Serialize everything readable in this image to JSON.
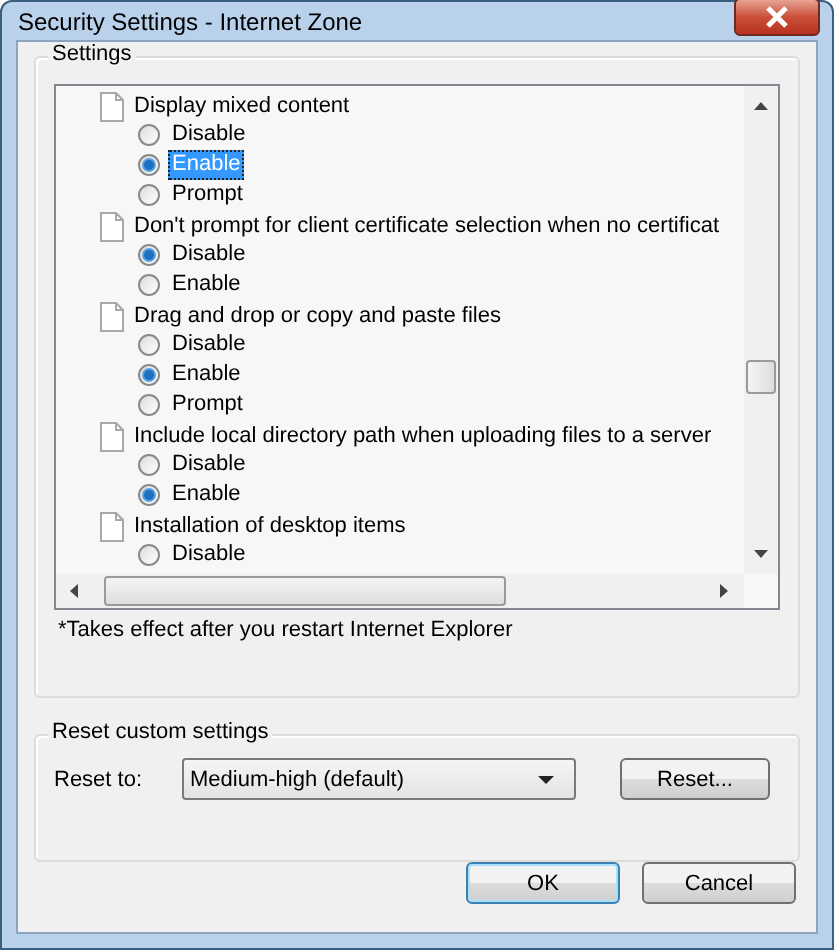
{
  "window": {
    "title": "Security Settings - Internet Zone"
  },
  "settings": {
    "title": "Settings",
    "items": [
      {
        "label": "Display mixed content",
        "options": [
          {
            "label": "Disable",
            "selected": false,
            "focused": false
          },
          {
            "label": "Enable",
            "selected": true,
            "focused": true
          },
          {
            "label": "Prompt",
            "selected": false,
            "focused": false
          }
        ]
      },
      {
        "label": "Don't prompt for client certificate selection when no certificat",
        "options": [
          {
            "label": "Disable",
            "selected": true,
            "focused": false
          },
          {
            "label": "Enable",
            "selected": false,
            "focused": false
          }
        ]
      },
      {
        "label": "Drag and drop or copy and paste files",
        "options": [
          {
            "label": "Disable",
            "selected": false,
            "focused": false
          },
          {
            "label": "Enable",
            "selected": true,
            "focused": false
          },
          {
            "label": "Prompt",
            "selected": false,
            "focused": false
          }
        ]
      },
      {
        "label": "Include local directory path when uploading files to a server",
        "options": [
          {
            "label": "Disable",
            "selected": false,
            "focused": false
          },
          {
            "label": "Enable",
            "selected": true,
            "focused": false
          }
        ]
      },
      {
        "label": "Installation of desktop items",
        "options": [
          {
            "label": "Disable",
            "selected": false,
            "focused": false
          }
        ]
      }
    ],
    "note": "*Takes effect after you restart Internet Explorer"
  },
  "reset": {
    "title": "Reset custom settings",
    "label": "Reset to:",
    "value": "Medium-high (default)",
    "button": "Reset..."
  },
  "buttons": [
    {
      "label": "OK",
      "default": true
    },
    {
      "label": "Cancel",
      "default": false
    }
  ]
}
